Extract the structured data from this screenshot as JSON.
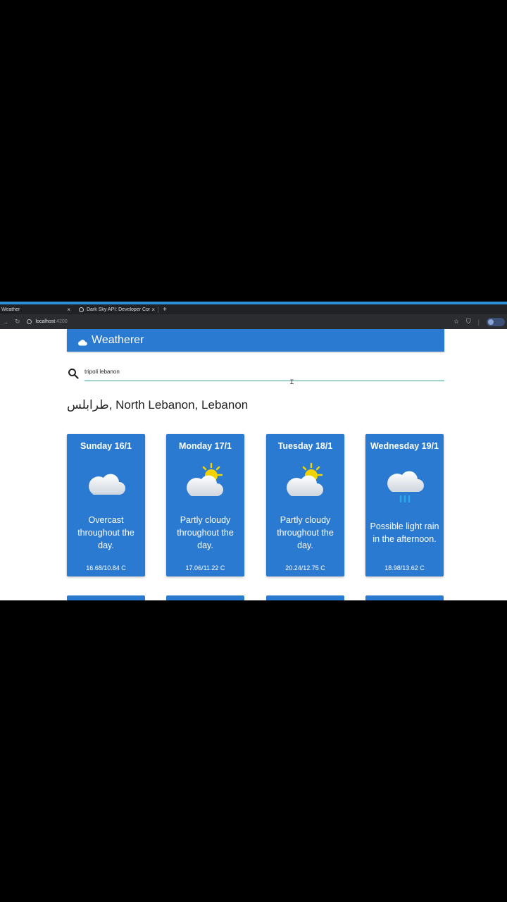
{
  "browser": {
    "tabs": [
      {
        "title": "Weather",
        "active": true
      },
      {
        "title": "Dark Sky API: Developer Console",
        "active": false
      }
    ],
    "tab_close_symbol": "×",
    "new_tab_symbol": "+",
    "url_host": "localhost",
    "url_port": ":4200"
  },
  "app": {
    "title": "Weatherer",
    "icon": "cloud-icon"
  },
  "search": {
    "value": "tripoli lebanon",
    "placeholder": ""
  },
  "location": {
    "name": "طرابلس, North Lebanon, Lebanon"
  },
  "forecast": [
    {
      "day": "Sunday 16/1",
      "icon": "cloudy-icon",
      "summary": "Overcast throughout the day.",
      "temp": "16.68/10.84 C"
    },
    {
      "day": "Monday 17/1",
      "icon": "partly-cloudy-day-icon",
      "summary": "Partly cloudy throughout the day.",
      "temp": "17.06/11.22 C"
    },
    {
      "day": "Tuesday 18/1",
      "icon": "partly-cloudy-day-icon",
      "summary": "Partly cloudy throughout the day.",
      "temp": "20.24/12.75 C"
    },
    {
      "day": "Wednesday 19/1",
      "icon": "rain-icon",
      "summary": "Possible light rain in the afternoon.",
      "temp": "18.98/13.62 C"
    }
  ],
  "colors": {
    "app_blue": "#2a7ad2",
    "sun_yellow": "#f2d200",
    "rain_blue": "#29a8ea",
    "search_underline": "#43a592"
  }
}
